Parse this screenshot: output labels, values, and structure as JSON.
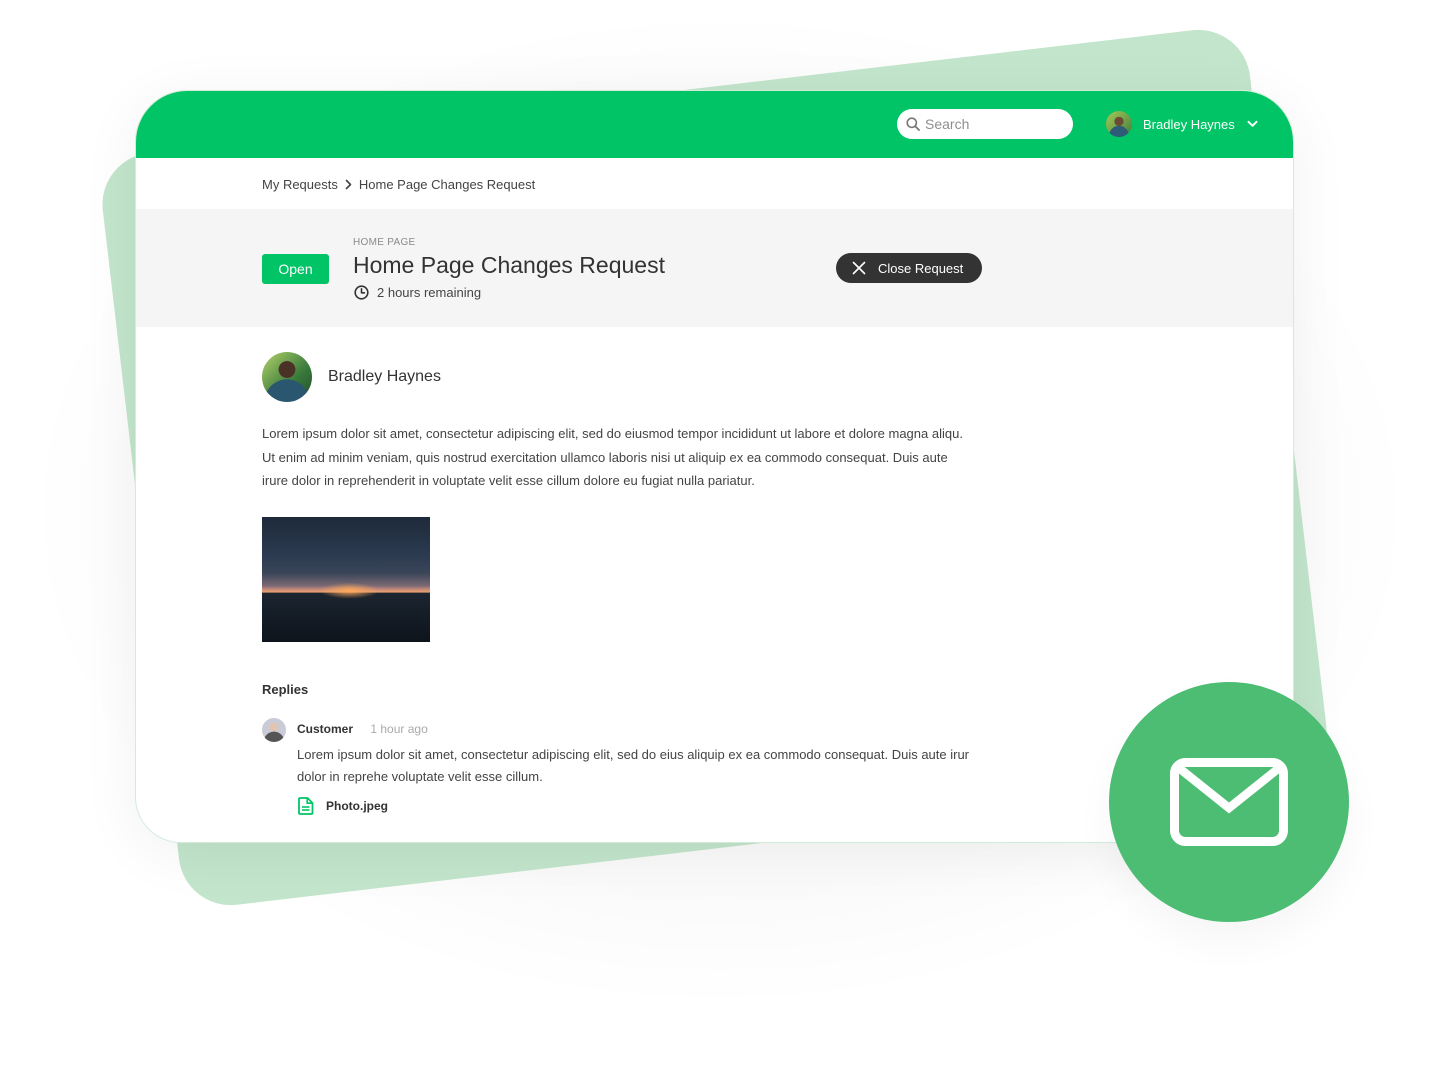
{
  "topbar": {
    "search": {
      "placeholder": "Search",
      "value": ""
    },
    "user": {
      "name": "Bradley Haynes"
    }
  },
  "breadcrumb": {
    "items": [
      "My Requests",
      "Home Page Changes Request"
    ]
  },
  "request": {
    "status": "Open",
    "category": "HOME PAGE",
    "title": "Home Page Changes Request",
    "time_remaining": "2 hours remaining",
    "close_button": "Close Request"
  },
  "post": {
    "author": "Bradley Haynes",
    "body_lines": [
      "Lorem ipsum dolor sit amet, consectetur adipiscing elit, sed do eiusmod tempor incididunt ut labore et dolore magna aliqu.",
      "Ut enim ad minim veniam, quis nostrud exercitation ullamco laboris nisi ut aliquip ex ea commodo consequat. Duis aute",
      "irure dolor in reprehenderit in voluptate velit esse cillum dolore eu fugiat nulla pariatur."
    ],
    "image_alt": "Sunset over the sea"
  },
  "replies": {
    "label": "Replies",
    "items": [
      {
        "author": "Customer",
        "time": "1 hour ago",
        "text_lines": [
          "Lorem ipsum dolor sit amet, consectetur adipiscing elit, sed do eius aliquip ex ea commodo consequat. Duis aute irur",
          "dolor in reprehe voluptate velit esse cillum."
        ],
        "attachment": "Photo.jpeg"
      }
    ]
  },
  "icons": {
    "search": "search-icon",
    "user_menu": "chevron-down-icon",
    "breadcrumb_sep": "chevron-right-icon",
    "time": "clock-icon",
    "close": "close-icon",
    "attachment": "file-icon",
    "badge": "mail-icon"
  },
  "colors": {
    "brand_green": "#00c466",
    "light_green": "#c2e5cb",
    "badge_green": "#4dbd74",
    "dark_button": "#333333",
    "header_panel": "#f5f5f5"
  }
}
